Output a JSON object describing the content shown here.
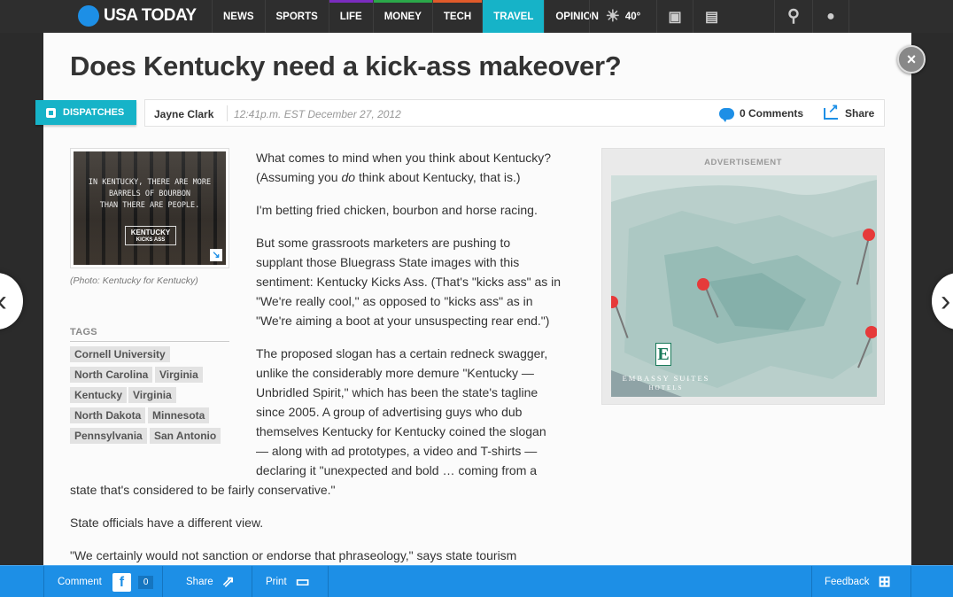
{
  "site": {
    "logo_text": "USA TODAY",
    "nav": [
      {
        "label": "NEWS",
        "color": "#2e2e2e"
      },
      {
        "label": "SPORTS",
        "color": "#2e2e2e"
      },
      {
        "label": "LIFE",
        "color": "#7b2cbf"
      },
      {
        "label": "MONEY",
        "color": "#2ba84a"
      },
      {
        "label": "TECH",
        "color": "#e05a2a"
      },
      {
        "label": "TRAVEL",
        "color": "#16b3c8"
      },
      {
        "label": "OPINION",
        "color": "#2e2e2e"
      }
    ],
    "weather_temp": "40°",
    "active_tab": "TRAVEL"
  },
  "article": {
    "headline": "Does Kentucky need a kick-ass makeover?",
    "section_badge": "DISPATCHES",
    "author": "Jayne Clark",
    "timestamp": "12:41p.m. EST December 27, 2012",
    "comments_label": "0 Comments",
    "share_label": "Share",
    "photo": {
      "line1": "IN KENTUCKY, THERE ARE MORE",
      "line2": "BARRELS OF BOURBON",
      "line3": "THAN THERE ARE PEOPLE.",
      "badge_top": "KENTUCKY",
      "badge_bottom": "KICKS ASS",
      "caption": "(Photo: Kentucky for Kentucky)"
    },
    "tags_label": "TAGS",
    "tags": [
      "Cornell University",
      "North Carolina",
      "Virginia",
      "Kentucky",
      "Virginia",
      "North Dakota",
      "Minnesota",
      "Pennsylvania",
      "San Antonio"
    ],
    "paragraphs": {
      "p1_a": "What comes to mind when you think about Kentucky?",
      "p1_b1": "(Assuming you ",
      "p1_b_em": "do",
      "p1_b2": " think about Kentucky, that is.)",
      "p2": "I'm betting fried chicken, bourbon and horse racing.",
      "p3_l1": "But some grassroots marketers are pushing to",
      "p3_l2": "supplant those Bluegrass State images with this",
      "p3_l3": "sentiment: Kentucky Kicks Ass. (That's \"kicks ass\" as in",
      "p3_l4": "\"We're really cool,\" as opposed to \"kicks ass\" as in",
      "p3_l5": "\"We're aiming a boot at your unsuspecting rear end.\")",
      "p4_l1": "The proposed slogan has a certain redneck swagger,",
      "p4_l2": "unlike the considerably more demure \"Kentucky —",
      "p4_l3": "Unbridled Spirit,\" which has been the state's tagline",
      "p4_l4": "since 2005. A group of advertising guys who dub",
      "p4_l5": "themselves Kentucky for Kentucky coined the slogan",
      "p4_l6": "— along with ad prototypes, a video and T-shirts —",
      "p4_l7": "declaring it \"unexpected and bold … coming from a",
      "p4_l8": "state that's considered to be fairly conservative.\"",
      "p5": "State officials have a different view.",
      "p6": "\"We certainly would not sanction or endorse that phraseology,\" says state tourism"
    }
  },
  "ad": {
    "label": "ADVERTISEMENT",
    "brand_letter": "E",
    "brand_line1": "EMBASSY SUITES",
    "brand_line2": "HOTELS"
  },
  "bottom_bar": {
    "comment_label": "Comment",
    "fb_glyph": "f",
    "comment_count": "0",
    "share_label": "Share",
    "print_label": "Print",
    "feedback_label": "Feedback"
  },
  "colors": {
    "accent": "#1d8fe6",
    "travel": "#16b3c8",
    "pin": "#e63a3a"
  }
}
